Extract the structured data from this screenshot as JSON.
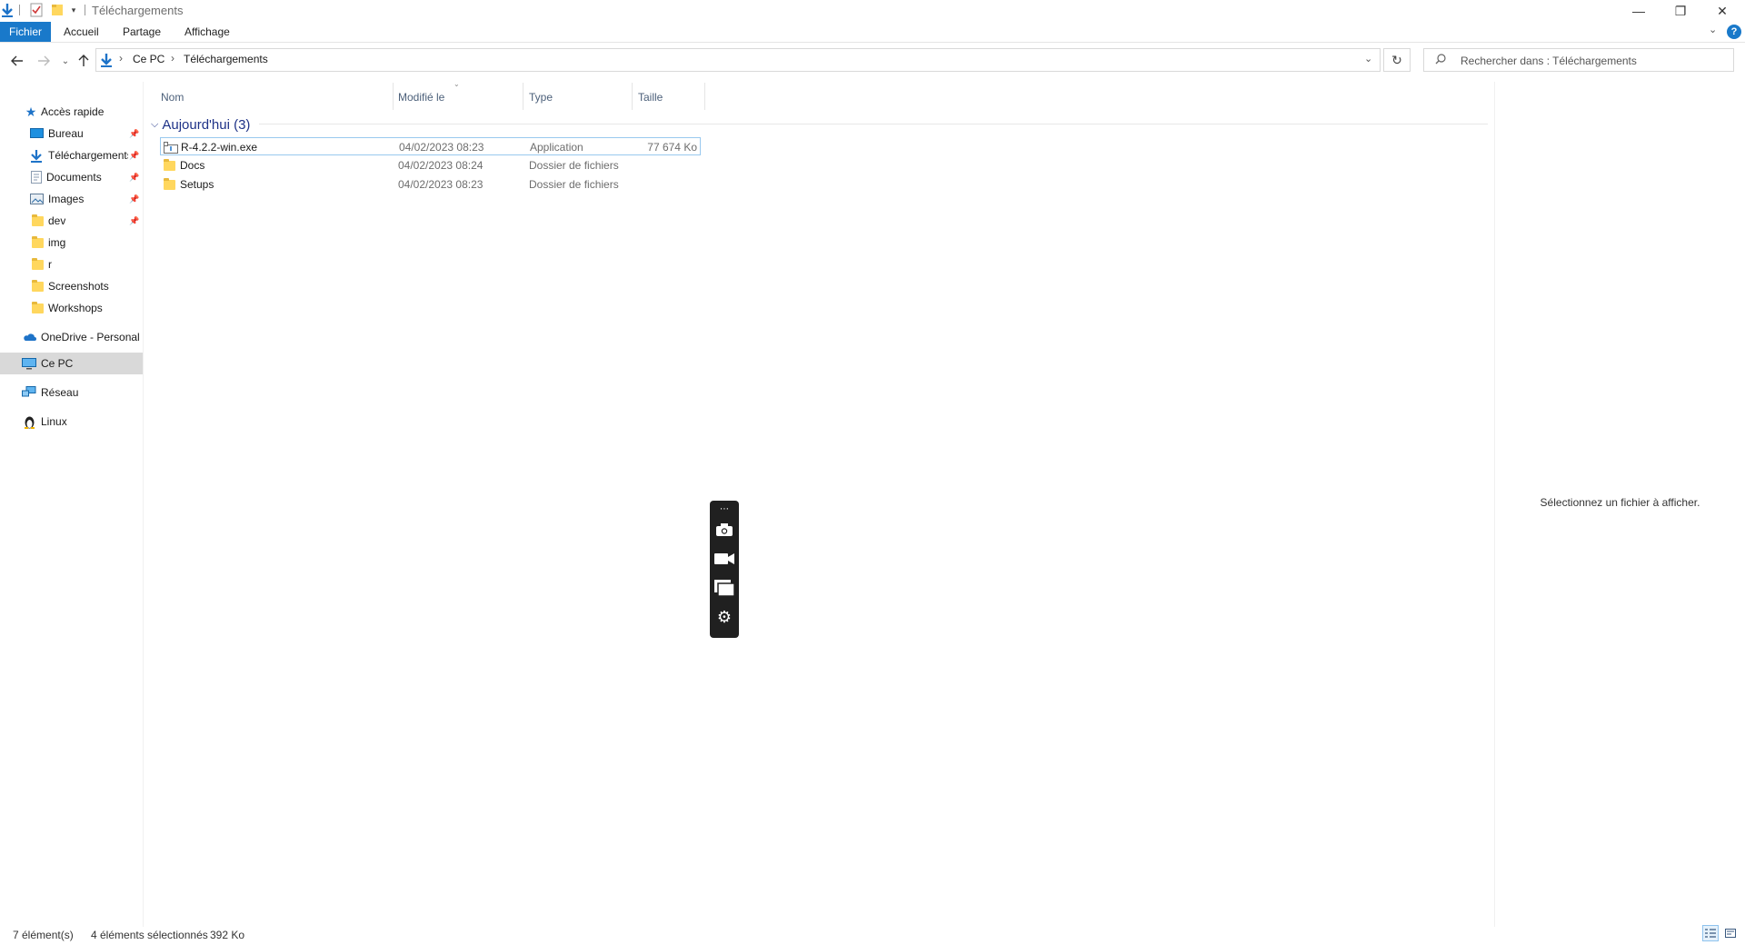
{
  "window": {
    "title": "Téléchargements",
    "controls": {
      "minimize": "—",
      "restore": "❐",
      "close": "✕"
    },
    "help": "?"
  },
  "ribbon": {
    "tabs": [
      "Fichier",
      "Accueil",
      "Partage",
      "Affichage"
    ]
  },
  "address": {
    "crumbs": [
      "Ce PC",
      "Téléchargements"
    ],
    "search_placeholder": "Rechercher dans : Téléchargements"
  },
  "sidebar": {
    "quick_access": "Accès rapide",
    "items": [
      {
        "label": "Bureau",
        "icon": "desktop-icon",
        "pinned": true
      },
      {
        "label": "Téléchargements",
        "icon": "download-icon",
        "pinned": true
      },
      {
        "label": "Documents",
        "icon": "documents-icon",
        "pinned": true
      },
      {
        "label": "Images",
        "icon": "pictures-icon",
        "pinned": true
      },
      {
        "label": "dev",
        "icon": "folder-icon",
        "pinned": true
      },
      {
        "label": "img",
        "icon": "folder-icon",
        "pinned": false
      },
      {
        "label": "r",
        "icon": "folder-icon",
        "pinned": false
      },
      {
        "label": "Screenshots",
        "icon": "folder-icon",
        "pinned": false
      },
      {
        "label": "Workshops",
        "icon": "folder-icon",
        "pinned": false
      }
    ],
    "onedrive": "OneDrive - Personal",
    "this_pc": "Ce PC",
    "network": "Réseau",
    "linux": "Linux"
  },
  "columns": {
    "name": "Nom",
    "modified": "Modifié le",
    "type": "Type",
    "size": "Taille"
  },
  "group": {
    "label": "Aujourd'hui (3)"
  },
  "files": [
    {
      "name": "R-4.2.2-win.exe",
      "modified": "04/02/2023 08:23",
      "type": "Application",
      "size": "77 674 Ko",
      "icon": "installer-icon"
    },
    {
      "name": "Docs",
      "modified": "04/02/2023 08:24",
      "type": "Dossier de fichiers",
      "size": "",
      "icon": "folder-icon"
    },
    {
      "name": "Setups",
      "modified": "04/02/2023 08:23",
      "type": "Dossier de fichiers",
      "size": "",
      "icon": "folder-icon"
    }
  ],
  "preview": {
    "message": "Sélectionnez un fichier à afficher."
  },
  "status": {
    "count": "7 élément(s)",
    "selected": "4 éléments sélectionnés",
    "size": "392 Ko"
  },
  "colors": {
    "accent": "#1979ca",
    "group_text": "#1e3287",
    "selection": "#d9d9d9",
    "folder": "#ffd75e"
  }
}
